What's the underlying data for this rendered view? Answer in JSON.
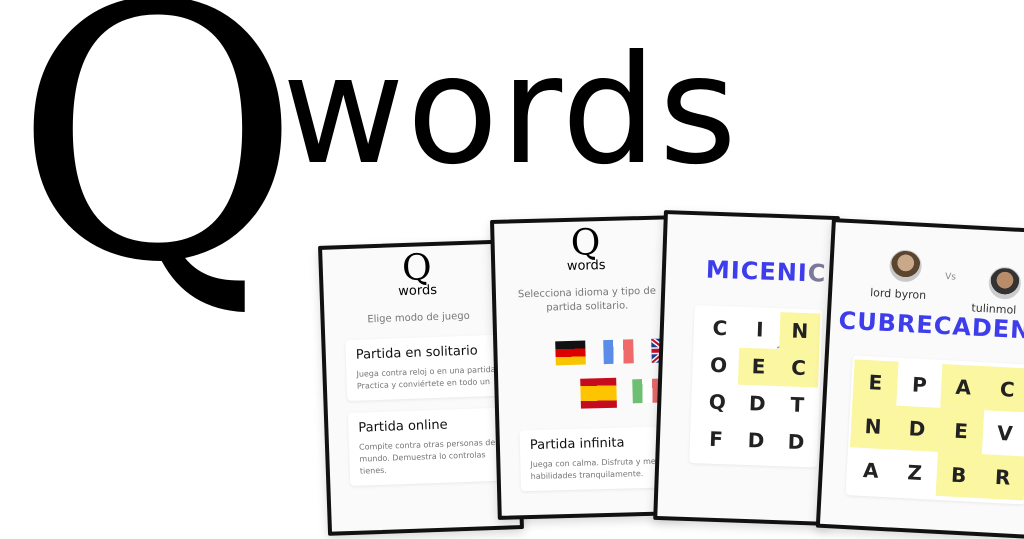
{
  "logo": {
    "q": "Q",
    "words": "words"
  },
  "card1": {
    "logo_q": "Q",
    "logo_words": "words",
    "subtitle": "Elige modo de juego",
    "options": [
      {
        "title": "Partida en solitario",
        "desc": [
          "Juega contra reloj o en una partida",
          "Practica y conviértete en todo un"
        ]
      },
      {
        "title": "Partida online",
        "desc": [
          "Compite contra otras personas del",
          "mundo. Demuestra lo controlas",
          "tienes."
        ]
      }
    ]
  },
  "card2": {
    "logo_q": "Q",
    "logo_words": "words",
    "subtitle": "Selecciona idioma y tipo de partida solitario.",
    "flags": [
      "germany-flag",
      "france-flag",
      "uk-flag",
      "spain-flag",
      "italy-flag"
    ],
    "option": {
      "title": "Partida infinita",
      "desc": [
        "Juega con calma. Disfruta y mejora",
        "habilidades tranquilamente."
      ]
    }
  },
  "card3": {
    "word_found": "MICENI",
    "word_rest": "C",
    "grid": [
      [
        "C",
        "I",
        "N"
      ],
      [
        "O",
        "E",
        "C"
      ],
      [
        "Q",
        "D",
        "T"
      ],
      [
        "F",
        "D",
        "D"
      ]
    ],
    "highlighted": [
      [
        0,
        2
      ],
      [
        1,
        1
      ],
      [
        1,
        2
      ]
    ]
  },
  "card4": {
    "player1": "lord byron",
    "vs": "Vs",
    "player2": "tulinmol",
    "word": "CUBRECADENA",
    "grid": [
      [
        "E",
        "P",
        "A",
        "C"
      ],
      [
        "N",
        "D",
        "E",
        "V"
      ],
      [
        "A",
        "Z",
        "B",
        "R"
      ]
    ],
    "highlighted": [
      [
        0,
        0
      ],
      [
        0,
        2
      ],
      [
        0,
        3
      ],
      [
        1,
        0
      ],
      [
        1,
        1
      ],
      [
        1,
        2
      ],
      [
        2,
        2
      ],
      [
        2,
        3
      ]
    ]
  },
  "colors": {
    "accent": "#3d3dec",
    "highlight": "#fbf6a0"
  }
}
